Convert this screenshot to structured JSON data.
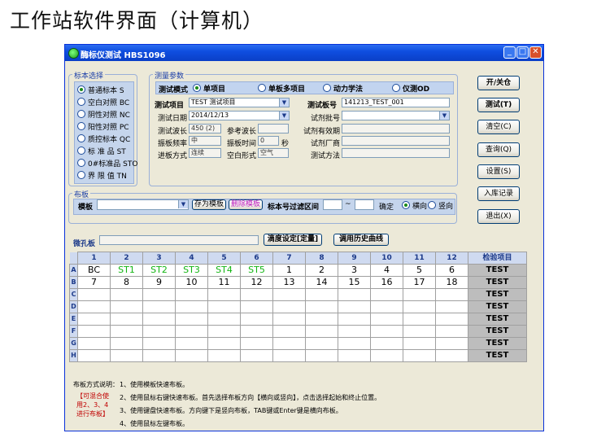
{
  "slide_title": "工作站软件界面（计算机）",
  "window": {
    "title": "酶标仪测试 HBS1096"
  },
  "standard_panel": {
    "caption": "标本选择",
    "options": [
      {
        "label": "普通标本 S",
        "selected": true
      },
      {
        "label": "空白对照 BC",
        "selected": false
      },
      {
        "label": "阴性对照 NC",
        "selected": false
      },
      {
        "label": "阳性对照 PC",
        "selected": false
      },
      {
        "label": "质控标本 QC",
        "selected": false
      },
      {
        "label": "标 准 品 ST",
        "selected": false
      },
      {
        "label": "0#标准品 STO",
        "selected": false
      },
      {
        "label": "界 限 值 TN",
        "selected": false
      }
    ]
  },
  "params": {
    "caption": "测量参数",
    "mode_label": "测试模式",
    "modes": [
      {
        "label": "单项目",
        "selected": true
      },
      {
        "label": "单板多项目",
        "selected": false
      },
      {
        "label": "动力学法",
        "selected": false
      },
      {
        "label": "仪测OD",
        "selected": false
      }
    ],
    "test_item_label": "测试项目",
    "test_item_value": "TEST 测试项目",
    "plate_no_label": "测试板号",
    "plate_no_value": "141213_TEST_001",
    "date_label": "测试日期",
    "date_value": "2014/12/13",
    "batch_label": "试剂批号",
    "batch_value": "",
    "wave_label": "测试波长",
    "wave_value": "450 (2)",
    "ref_wave_label": "参考波长",
    "ref_wave_value": "",
    "expiry_label": "试剂有效期",
    "expiry_value": "",
    "shake_freq_label": "振板频率",
    "shake_freq_value": "中",
    "shake_time_label": "振板时间",
    "shake_time_value": "0",
    "shake_time_unit": "秒",
    "maker_label": "试剂厂商",
    "maker_value": "",
    "feed_label": "进板方式",
    "feed_value": "连续",
    "blank_label": "空白形式",
    "blank_value": "空气",
    "method_label": "测试方法",
    "method_value": ""
  },
  "buttons": {
    "open_close": "开/关仓",
    "test": "测试(T)",
    "clear": "清空(C)",
    "query": "查询(Q)",
    "settings": "设置(S)",
    "entry": "入库记录",
    "exit": "退出(X)"
  },
  "plate": {
    "caption": "布板",
    "template_label": "模板",
    "template_value": "",
    "save_template": "存为模板",
    "delete_template": "删除模板",
    "filter_label": "标本号过滤区间",
    "filter_from": "",
    "filter_sep": "~",
    "filter_to": "",
    "confirm_label": "确定",
    "horizontal": "横向",
    "vertical": "竖向",
    "direction": "horizontal"
  },
  "microwell": {
    "label": "微孔板",
    "value": "",
    "titer_button": "滴度设定[定量]",
    "history_button": "调用历史曲线"
  },
  "grid": {
    "columns": [
      "1",
      "2",
      "3",
      "4",
      "5",
      "6",
      "7",
      "8",
      "9",
      "10",
      "11",
      "12"
    ],
    "item_header": "检验项目",
    "rows": [
      {
        "label": "A",
        "cells": [
          {
            "v": "BC",
            "c": ""
          },
          {
            "v": "ST1",
            "c": "green"
          },
          {
            "v": "ST2",
            "c": "green"
          },
          {
            "v": "ST3",
            "c": "green"
          },
          {
            "v": "ST4",
            "c": "green"
          },
          {
            "v": "ST5",
            "c": "green"
          },
          {
            "v": "1",
            "c": ""
          },
          {
            "v": "2",
            "c": ""
          },
          {
            "v": "3",
            "c": ""
          },
          {
            "v": "4",
            "c": ""
          },
          {
            "v": "5",
            "c": ""
          },
          {
            "v": "6",
            "c": ""
          }
        ],
        "item": "TEST"
      },
      {
        "label": "B",
        "cells": [
          {
            "v": "7",
            "c": ""
          },
          {
            "v": "8",
            "c": ""
          },
          {
            "v": "9",
            "c": ""
          },
          {
            "v": "10",
            "c": ""
          },
          {
            "v": "11",
            "c": ""
          },
          {
            "v": "12",
            "c": ""
          },
          {
            "v": "13",
            "c": ""
          },
          {
            "v": "14",
            "c": ""
          },
          {
            "v": "15",
            "c": ""
          },
          {
            "v": "16",
            "c": ""
          },
          {
            "v": "17",
            "c": ""
          },
          {
            "v": "18",
            "c": ""
          }
        ],
        "item": "TEST"
      },
      {
        "label": "C",
        "cells": [],
        "item": "TEST"
      },
      {
        "label": "D",
        "cells": [],
        "item": "TEST"
      },
      {
        "label": "E",
        "cells": [],
        "item": "TEST"
      },
      {
        "label": "F",
        "cells": [],
        "item": "TEST"
      },
      {
        "label": "G",
        "cells": [],
        "item": "TEST"
      },
      {
        "label": "H",
        "cells": [],
        "item": "TEST"
      }
    ]
  },
  "notes": {
    "header": "布板方式说明：",
    "side": [
      "【可混合使",
      "用2、3、4",
      "进行布板】"
    ],
    "lines": [
      "1、使用模板快速布板。",
      "2、使用鼠标右键快速布板。首先选择布板方向【横向或竖向】，点击选择起始和终止位置。",
      "3、使用键盘快速布板。方向键下是竖向布板，TAB键或Enter键是横向布板。",
      "4、使用鼠标左键布板。"
    ]
  },
  "colors": {
    "titlebar": "#0f4ee0",
    "window_bg": "#ece9d8",
    "accent_green": "#13b513",
    "test_cell": "#bdbdbd"
  }
}
